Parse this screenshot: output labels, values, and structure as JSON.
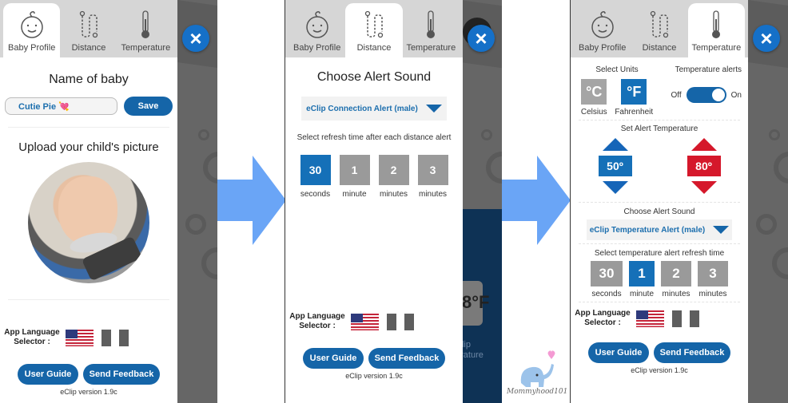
{
  "tabs": [
    {
      "label": "Baby Profile",
      "icon": "baby-face-icon"
    },
    {
      "label": "Distance",
      "icon": "distance-path-icon"
    },
    {
      "label": "Temperature",
      "icon": "thermometer-icon"
    }
  ],
  "close_icon": "×",
  "screen1": {
    "active_tab": "Baby Profile",
    "name_heading": "Name of baby",
    "name_value": "Cutie Pie 💘",
    "save_label": "Save",
    "upload_heading": "Upload your child's picture",
    "photo_alt": "baby photo"
  },
  "screen2": {
    "active_tab": "Distance",
    "heading": "Choose Alert Sound",
    "sound_selected": "eClip Connection Alert (male)",
    "refresh_heading": "Select refresh time after each distance alert",
    "refresh_options": [
      {
        "value": "30",
        "unit": "seconds",
        "selected": true
      },
      {
        "value": "1",
        "unit": "minute",
        "selected": false
      },
      {
        "value": "2",
        "unit": "minutes",
        "selected": false
      },
      {
        "value": "3",
        "unit": "minutes",
        "selected": false
      }
    ],
    "backdrop_temp": "8°F",
    "backdrop_text_1": "Clip",
    "backdrop_text_2": "erature"
  },
  "screen3": {
    "active_tab": "Temperature",
    "units_heading": "Select Units",
    "alerts_heading": "Temperature alerts",
    "units": [
      {
        "symbol": "°C",
        "label": "Celsius",
        "selected": false
      },
      {
        "symbol": "°F",
        "label": "Fahrenheit",
        "selected": true
      }
    ],
    "toggle_off": "Off",
    "toggle_on": "On",
    "alerts_enabled": true,
    "set_alert_heading": "Set Alert Temperature",
    "low_temp": "50º",
    "high_temp": "80º",
    "sound_heading": "Choose Alert Sound",
    "sound_selected": "eClip Temperature Alert (male)",
    "refresh_heading": "Select temperature alert refresh time",
    "refresh_options": [
      {
        "value": "30",
        "unit": "seconds",
        "selected": false
      },
      {
        "value": "1",
        "unit": "minute",
        "selected": true
      },
      {
        "value": "2",
        "unit": "minutes",
        "selected": false
      },
      {
        "value": "3",
        "unit": "minutes",
        "selected": false
      }
    ]
  },
  "footer": {
    "language_label_1": "App Language",
    "language_label_2": "Selector :",
    "user_guide": "User Guide",
    "send_feedback": "Send Feedback",
    "version": "eClip version 1.9c"
  },
  "watermark": "Mommyhood101",
  "colors": {
    "primary_blue": "#1565a8",
    "selected_blue": "#1570b8",
    "alert_red": "#d5182b",
    "arrow_blue": "#6aa5f6",
    "option_gray": "#9a9a9a"
  }
}
